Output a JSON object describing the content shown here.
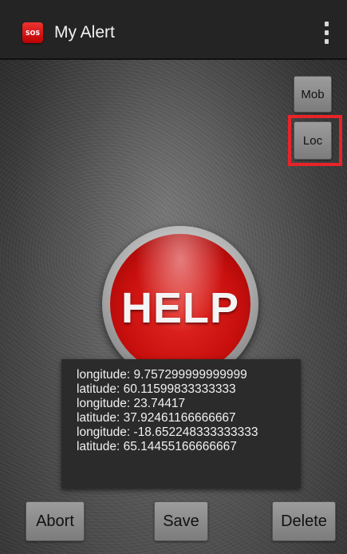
{
  "action_bar": {
    "app_icon_text": "SOS",
    "title": "My Alert",
    "overflow_icon": "overflow-menu-icon"
  },
  "side_buttons": {
    "mob_label": "Mob",
    "loc_label": "Loc"
  },
  "help_button": {
    "label": "HELP"
  },
  "coordinates": [
    "longitude: 9.757299999999999",
    "latitude: 60.11599833333333",
    "longitude: 23.74417",
    "latitude: 37.92461166666667",
    "longitude: -18.652248333333333",
    "latitude: 65.14455166666667"
  ],
  "bottom_buttons": {
    "abort_label": "Abort",
    "save_label": "Save",
    "delete_label": "Delete"
  },
  "colors": {
    "help_red": "#c9100e",
    "highlight_red": "#e8232a",
    "action_bar": "#242424"
  }
}
